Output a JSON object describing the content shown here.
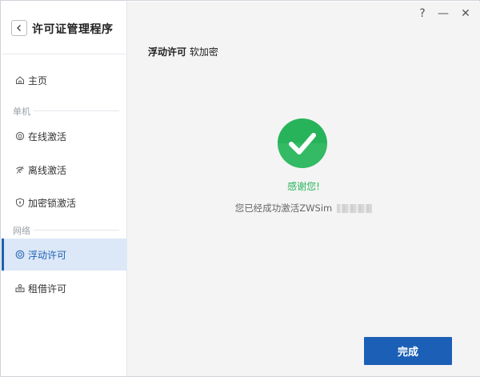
{
  "app": {
    "title": "许可证管理程序"
  },
  "sidebar": {
    "home": "主页",
    "sections": {
      "standalone": "单机",
      "network": "网络"
    },
    "items": {
      "online": "在线激活",
      "offline": "离线激活",
      "dongle": "加密锁激活",
      "floating": "浮动许可",
      "borrow": "租借许可"
    },
    "active_item": "floating"
  },
  "window_controls": {
    "help": "?",
    "minimize": "—",
    "close": "✕"
  },
  "main": {
    "header": {
      "strong": "浮动许可",
      "rest": "软加密"
    },
    "success": {
      "thanks": "感谢您!",
      "message": "您已经成功激活ZWSim"
    },
    "done_button": "完成"
  },
  "colors": {
    "accent": "#1b5fb7",
    "success": "#27b35a",
    "active_bg": "#dce8f7"
  },
  "icons": [
    "back-icon",
    "home-icon",
    "online-icon",
    "offline-icon",
    "shield-icon",
    "floating-icon",
    "borrow-icon",
    "check-icon"
  ]
}
